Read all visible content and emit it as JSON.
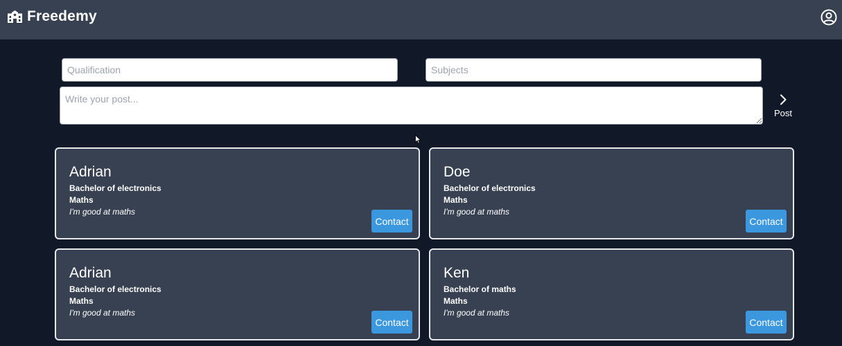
{
  "app": {
    "brand_name": "Freedemy",
    "brand_icon": "school-building-icon",
    "profile_icon": "user-circle-icon"
  },
  "form": {
    "qualification_placeholder": "Qualification",
    "subjects_placeholder": "Subjects",
    "post_placeholder": "Write your post...",
    "post_button_label": "Post",
    "post_button_icon": "chevron-right-icon"
  },
  "posts": [
    {
      "name": "Adrian",
      "qualification": "Bachelor of electronics",
      "subject": "Maths",
      "description": "I'm good at maths",
      "contact_label": "Contact"
    },
    {
      "name": "Doe",
      "qualification": "Bachelor of electronics",
      "subject": "Maths",
      "description": "I'm good at maths",
      "contact_label": "Contact"
    },
    {
      "name": "Adrian",
      "qualification": "Bachelor of electronics",
      "subject": "Maths",
      "description": "I'm good at maths",
      "contact_label": "Contact"
    },
    {
      "name": "Ken",
      "qualification": "Bachelor of maths",
      "subject": "Maths",
      "description": "I'm good at maths",
      "contact_label": "Contact"
    }
  ],
  "colors": {
    "page_background": "#111827",
    "navbar_background": "#374151",
    "card_background": "#374151",
    "card_border": "#e5e7eb",
    "contact_button": "#3b97de"
  }
}
